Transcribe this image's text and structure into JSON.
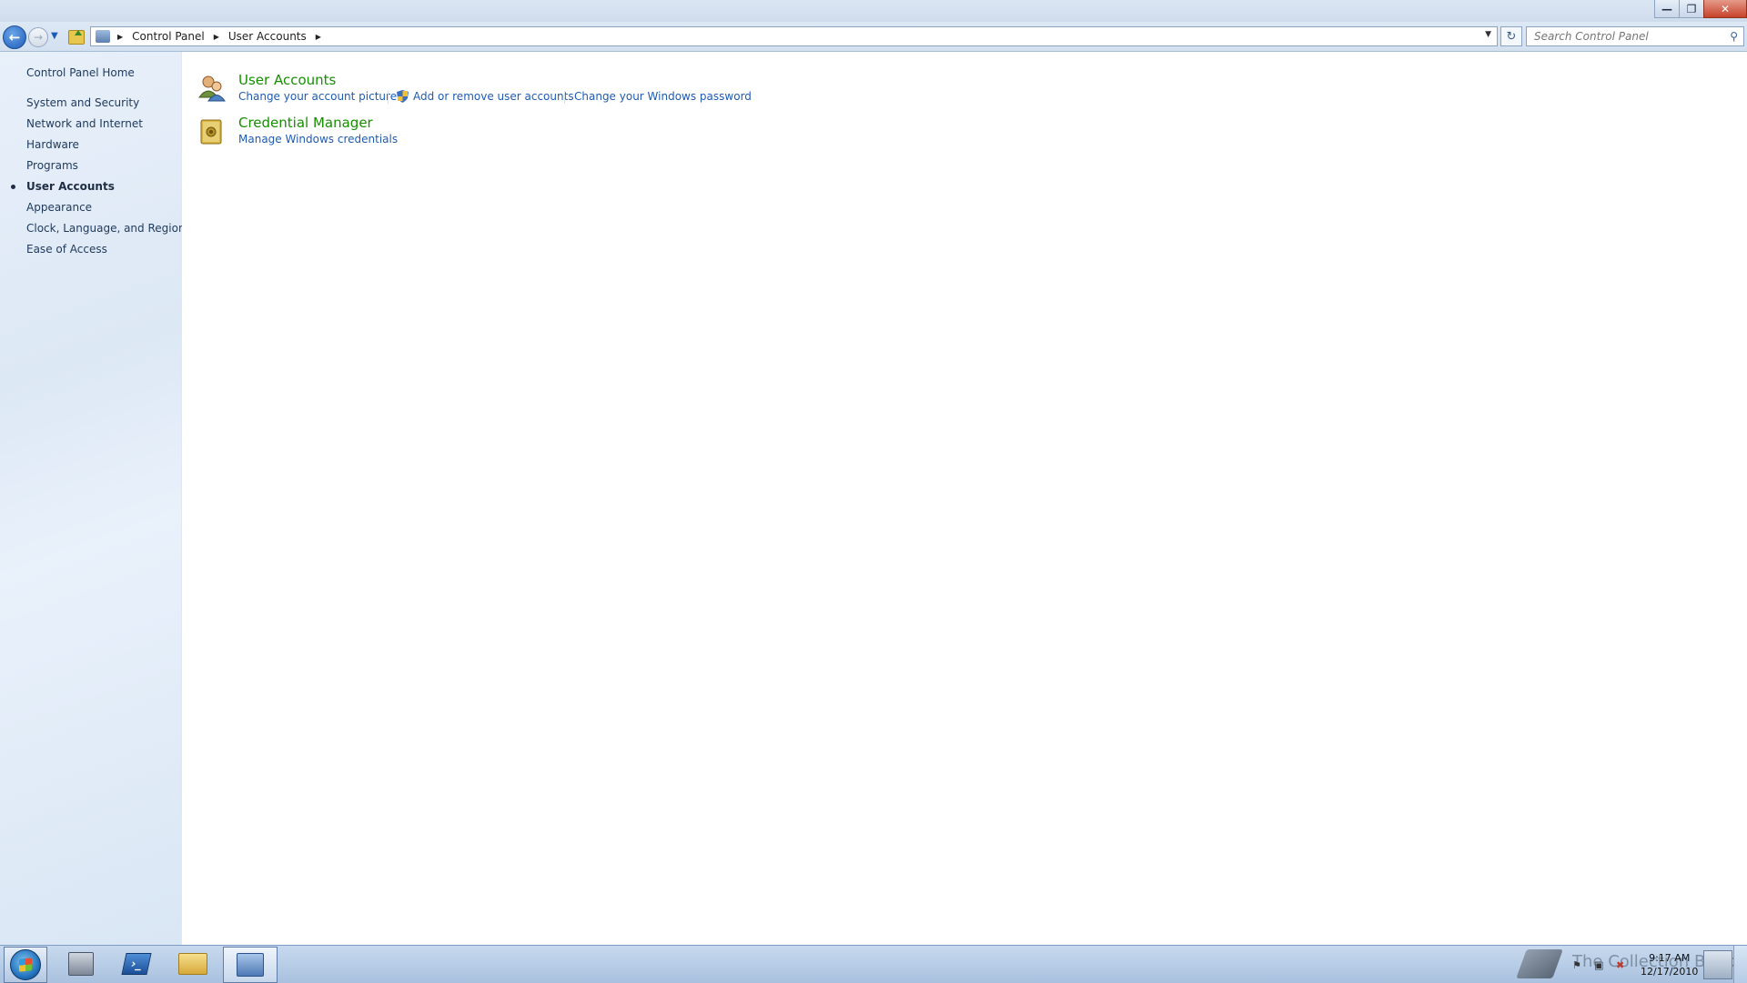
{
  "addressbar": {
    "breadcrumbs": [
      "Control Panel",
      "User Accounts"
    ],
    "search_placeholder": "Search Control Panel"
  },
  "leftnav": {
    "items": [
      {
        "label": "Control Panel Home",
        "active": false
      },
      {
        "label": "System and Security",
        "active": false
      },
      {
        "label": "Network and Internet",
        "active": false
      },
      {
        "label": "Hardware",
        "active": false
      },
      {
        "label": "Programs",
        "active": false
      },
      {
        "label": "User Accounts",
        "active": true
      },
      {
        "label": "Appearance",
        "active": false
      },
      {
        "label": "Clock, Language, and Region",
        "active": false
      },
      {
        "label": "Ease of Access",
        "active": false
      }
    ]
  },
  "main": {
    "categories": [
      {
        "title": "User Accounts",
        "icon": "user-accounts-icon",
        "links": [
          "Change your account picture",
          "Add or remove user accounts",
          "Change your Windows password"
        ]
      },
      {
        "title": "Credential Manager",
        "icon": "credential-manager-icon",
        "links": [
          "Manage Windows credentials"
        ]
      }
    ]
  },
  "taskbar": {
    "watermark": "The Collection Book",
    "time": "9:17 AM",
    "date": "12/17/2010"
  },
  "colors": {
    "category_title": "#168f00",
    "link": "#1e5bb3",
    "left_nav_text": "#1e395b",
    "close_button": "#c7432a"
  }
}
